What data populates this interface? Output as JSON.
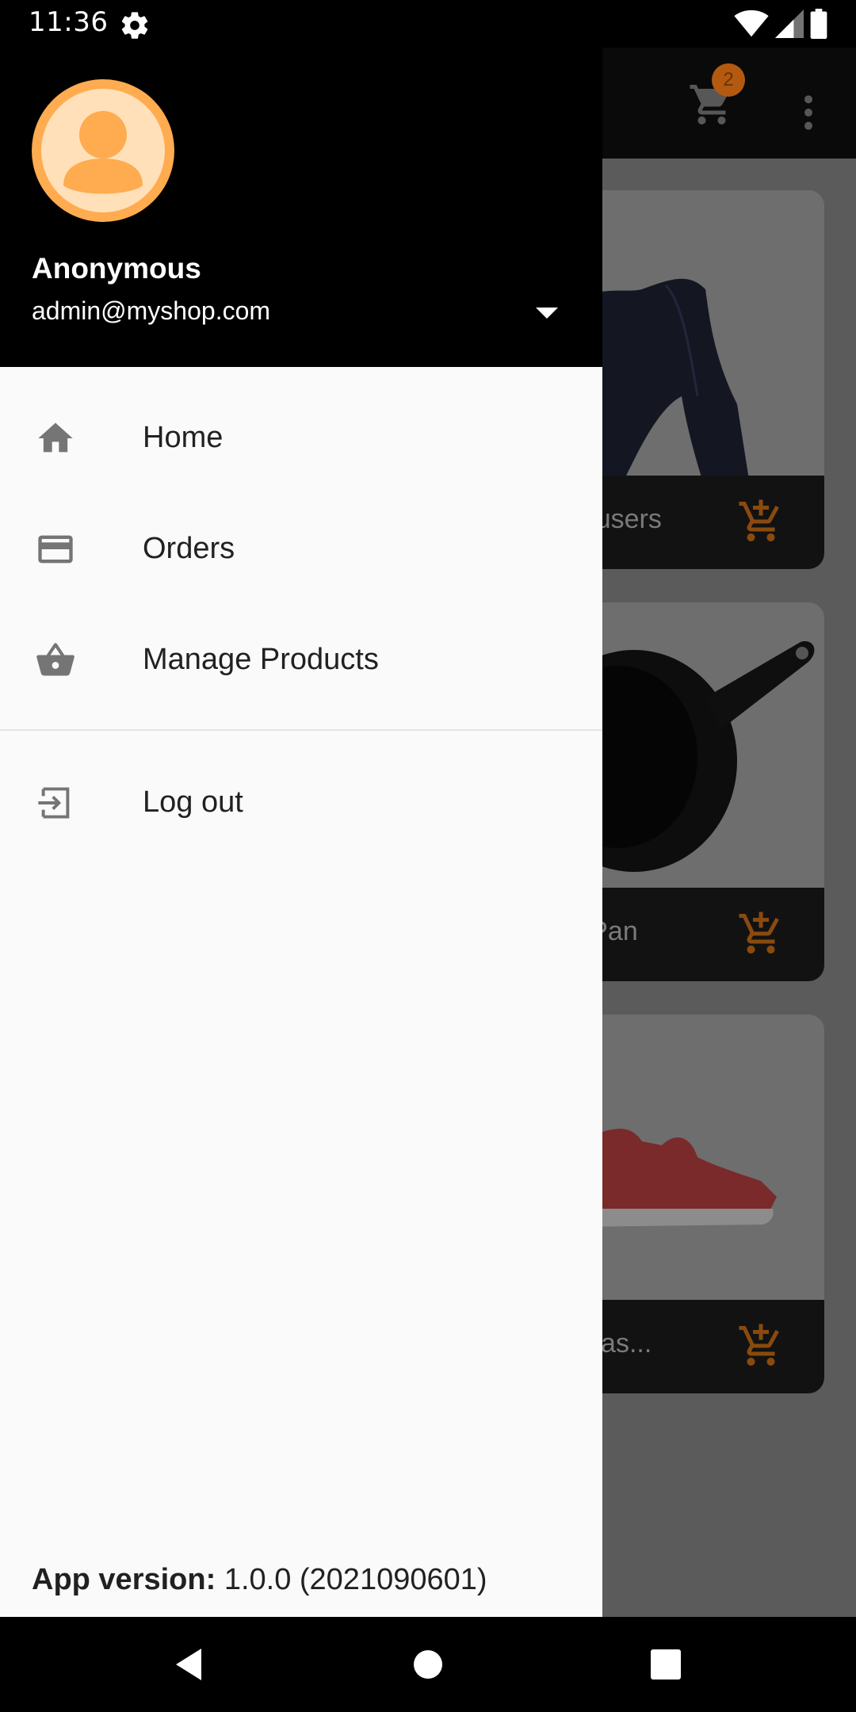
{
  "status_bar": {
    "time": "11:36",
    "icons": [
      "settings-gear-icon",
      "wifi-icon",
      "cell-signal-icon",
      "battery-icon"
    ]
  },
  "app": {
    "cart_badge": "2",
    "products": [
      {
        "title": "Trousers"
      },
      {
        "title": "A Pan"
      },
      {
        "title": "Adidas..."
      }
    ]
  },
  "drawer": {
    "user_name": "Anonymous",
    "user_email": "admin@myshop.com",
    "menu": [
      {
        "label": "Home",
        "icon": "home-icon"
      },
      {
        "label": "Orders",
        "icon": "credit-card-icon"
      },
      {
        "label": "Manage Products",
        "icon": "basket-icon"
      }
    ],
    "logout_label": "Log out",
    "version_label": "App version:",
    "version_value": "1.0.0 (2021090601)"
  },
  "colors": {
    "accent": "#FF9800",
    "avatar": "#FFAB50",
    "drawer_bg": "#FAFAFA",
    "header_bg": "#000000"
  }
}
